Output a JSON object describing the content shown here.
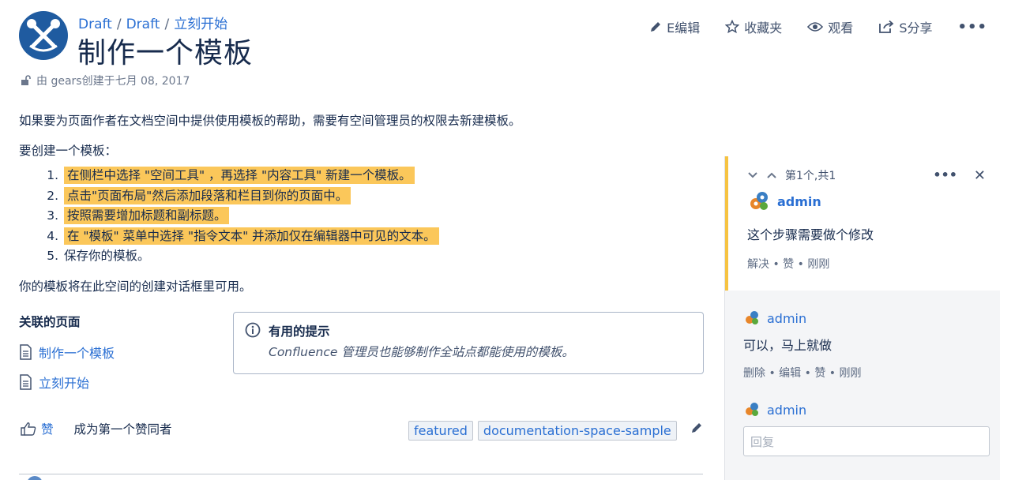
{
  "breadcrumb": {
    "items": [
      "Draft",
      "Draft",
      "立刻开始"
    ],
    "separator": "/"
  },
  "page": {
    "title": "制作一个模板",
    "byline": "由 gears创建于七月 08, 2017"
  },
  "toolbar": {
    "edit": "E编辑",
    "favorite": "收藏夹",
    "watch": "观看",
    "share": "S分享",
    "more": "•••"
  },
  "content": {
    "intro": "如果要为页面作者在文档空间中提供使用模板的帮助，需要有空间管理员的权限去新建模板。",
    "create_heading": "要创建一个模板：",
    "steps": [
      {
        "num": "1.",
        "text": "在侧栏中选择 \"空间工具\" ，再选择 \"内容工具\" 新建一个模板。",
        "highlight": true
      },
      {
        "num": "2.",
        "text": "点击\"页面布局\"然后添加段落和栏目到你的页面中。",
        "highlight": true
      },
      {
        "num": "3.",
        "text": "按照需要增加标题和副标题。",
        "highlight": true
      },
      {
        "num": "4.",
        "text": "在 \"模板\" 菜单中选择 \"指令文本\" 并添加仅在编辑器中可见的文本。",
        "highlight": true
      },
      {
        "num": "5.",
        "text": "保存你的模板。",
        "highlight": false
      }
    ],
    "outro": "你的模板将在此空间的创建对话框里可用。"
  },
  "related": {
    "heading": "关联的页面",
    "links": [
      "制作一个模板",
      "立刻开始"
    ]
  },
  "tip": {
    "title": "有用的提示",
    "body": "Confluence 管理员也能够制作全站点都能使用的模板。"
  },
  "likes": {
    "like_label": "赞",
    "text": "成为第一个赞同者"
  },
  "labels": [
    "featured",
    "documentation-space-sample"
  ],
  "panel": {
    "nav_text": "第1个,共1",
    "dots": "•••",
    "close": "✕",
    "comment": {
      "author": "admin",
      "text": "这个步骤需要做个修改",
      "meta": "解决 • 赞 • 刚刚"
    },
    "reply": {
      "author": "admin",
      "text": "可以，马上就做",
      "meta": "删除 • 编辑 • 赞 • 刚刚"
    },
    "new_reply": {
      "author": "admin",
      "placeholder": "回复"
    }
  },
  "colors": {
    "accent": "#2a6fd3",
    "highlight": "#fbc75a",
    "logo": "#1f5ba0",
    "panel_marker": "#f6c342"
  }
}
